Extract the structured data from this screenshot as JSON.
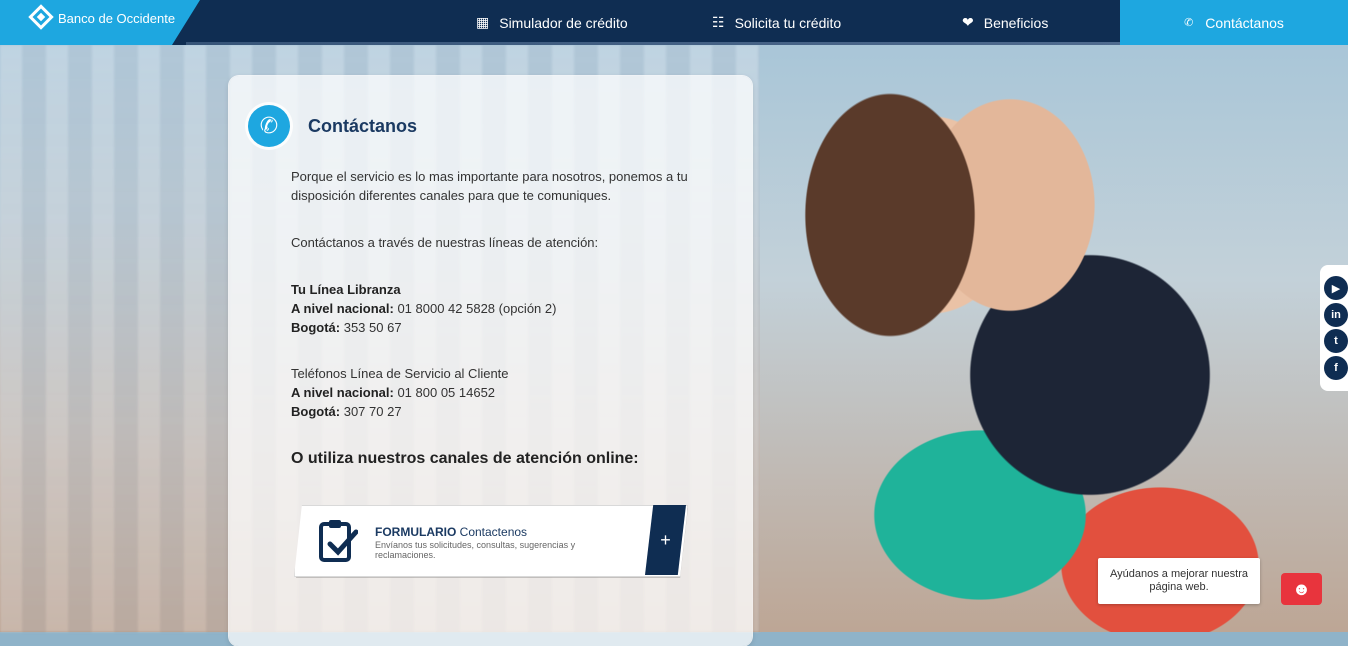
{
  "header": {
    "brand": "Banco de Occidente",
    "nav": [
      {
        "icon": "calculator-icon",
        "label": "Simulador de crédito"
      },
      {
        "icon": "money-stack-icon",
        "label": "Solicita tu crédito"
      },
      {
        "icon": "heart-hands-icon",
        "label": "Beneficios"
      },
      {
        "icon": "phone-icon",
        "label": "Contáctanos"
      }
    ]
  },
  "card": {
    "title": "Contáctanos",
    "intro": "Porque el servicio es lo mas importante para nosotros, ponemos a tu disposición diferentes canales para que te comuniques.",
    "lines_intro": "Contáctanos a través de nuestras líneas de atención:",
    "libranza": {
      "heading": "Tu Línea Libranza",
      "nacional_label": "A nivel nacional:",
      "nacional_value": " 01 8000 42 5828 (opción 2)",
      "bogota_label": "Bogotá:",
      "bogota_value": " 353 50 67"
    },
    "servicio": {
      "heading": "Teléfonos Línea de Servicio al Cliente",
      "nacional_label": "A nivel nacional:",
      "nacional_value": " 01 800 05 14652",
      "bogota_label": "Bogotá:",
      "bogota_value": " 307 70 27"
    },
    "online_title": "O utiliza nuestros canales de atención online:",
    "form_button": {
      "title_bold": "FORMULARIO",
      "title_rest": " Contactenos",
      "subtitle": "Envíanos tus solicitudes, consultas, sugerencias y reclamaciones.",
      "plus": "+"
    }
  },
  "social": [
    "youtube-icon",
    "linkedin-icon",
    "twitter-icon",
    "facebook-icon"
  ],
  "feedback": {
    "text": "Ayúdanos a mejorar nuestra página web."
  },
  "colors": {
    "brand_blue": "#1ea7e0",
    "navy": "#0f2d52",
    "feedback_red": "#e8343d"
  }
}
